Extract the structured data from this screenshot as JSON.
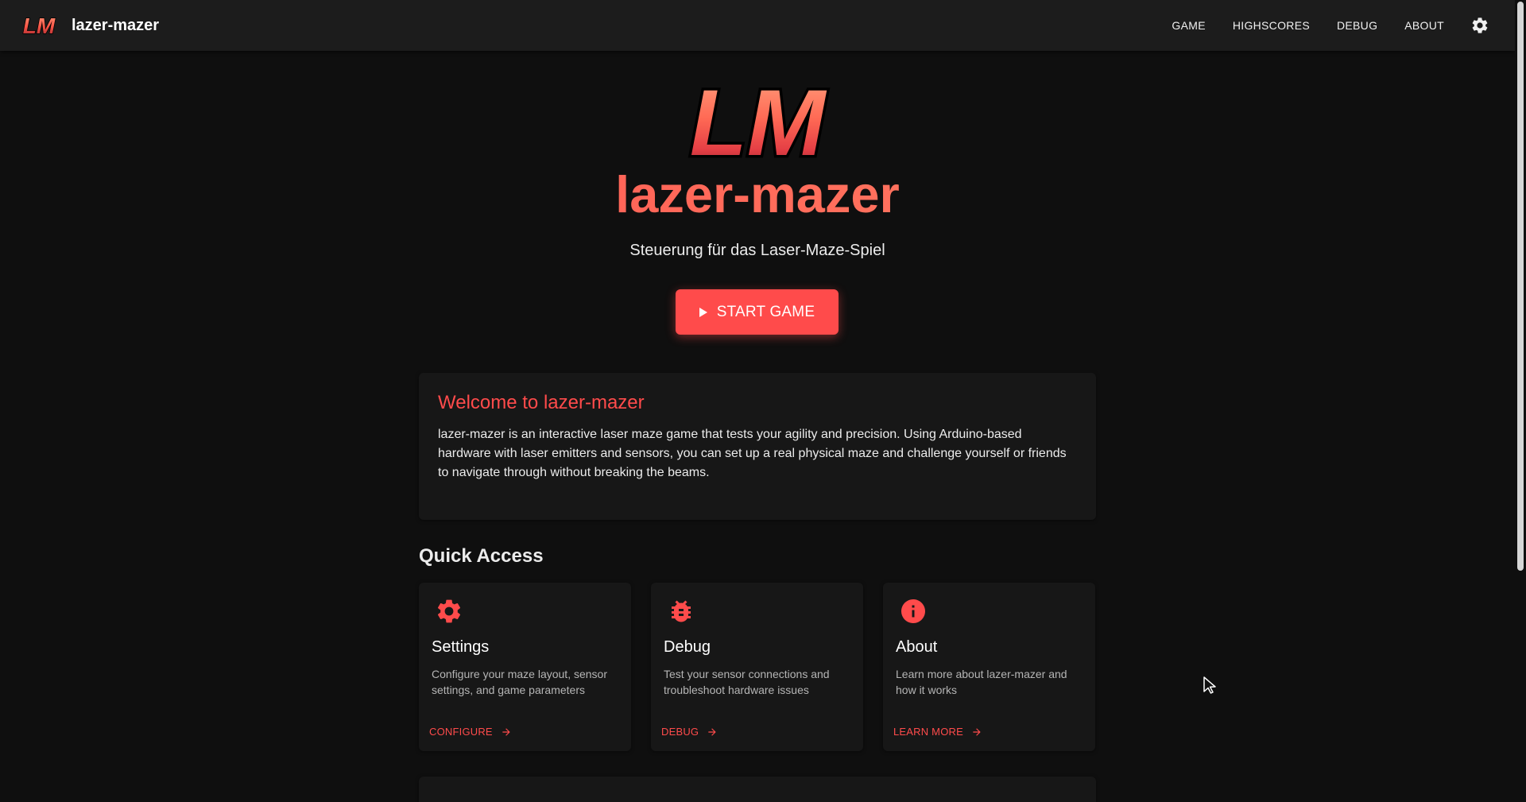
{
  "appbar": {
    "brand_logo_text": "LM",
    "title": "lazer-mazer",
    "nav": [
      "GAME",
      "HIGHSCORES",
      "DEBUG",
      "ABOUT"
    ],
    "settings_icon": "gear-icon"
  },
  "hero": {
    "logo_text": "LM",
    "title": "lazer-mazer",
    "subtitle": "Steuerung für das Laser-Maze-Spiel",
    "start_label": "START GAME",
    "start_icon": "play-icon"
  },
  "welcome": {
    "title": "Welcome to lazer-mazer",
    "body": "lazer-mazer is an interactive laser maze game that tests your agility and precision. Using Arduino-based hardware with laser emitters and sensors, you can set up a real physical maze and challenge yourself or friends to navigate through without breaking the beams."
  },
  "quick_access": {
    "title": "Quick Access",
    "cards": [
      {
        "icon": "gear-icon",
        "title": "Settings",
        "description": "Configure your maze layout, sensor settings, and game parameters",
        "link": "CONFIGURE"
      },
      {
        "icon": "bug-icon",
        "title": "Debug",
        "description": "Test your sensor connections and troubleshoot hardware issues",
        "link": "DEBUG"
      },
      {
        "icon": "info-icon",
        "title": "About",
        "description": "Learn more about lazer-mazer and how it works",
        "link": "LEARN MORE"
      }
    ]
  },
  "colors": {
    "accent": "#ff4b4b",
    "appbar": "#1c1c1c",
    "background": "#0f0f0f",
    "card": "#171717"
  }
}
